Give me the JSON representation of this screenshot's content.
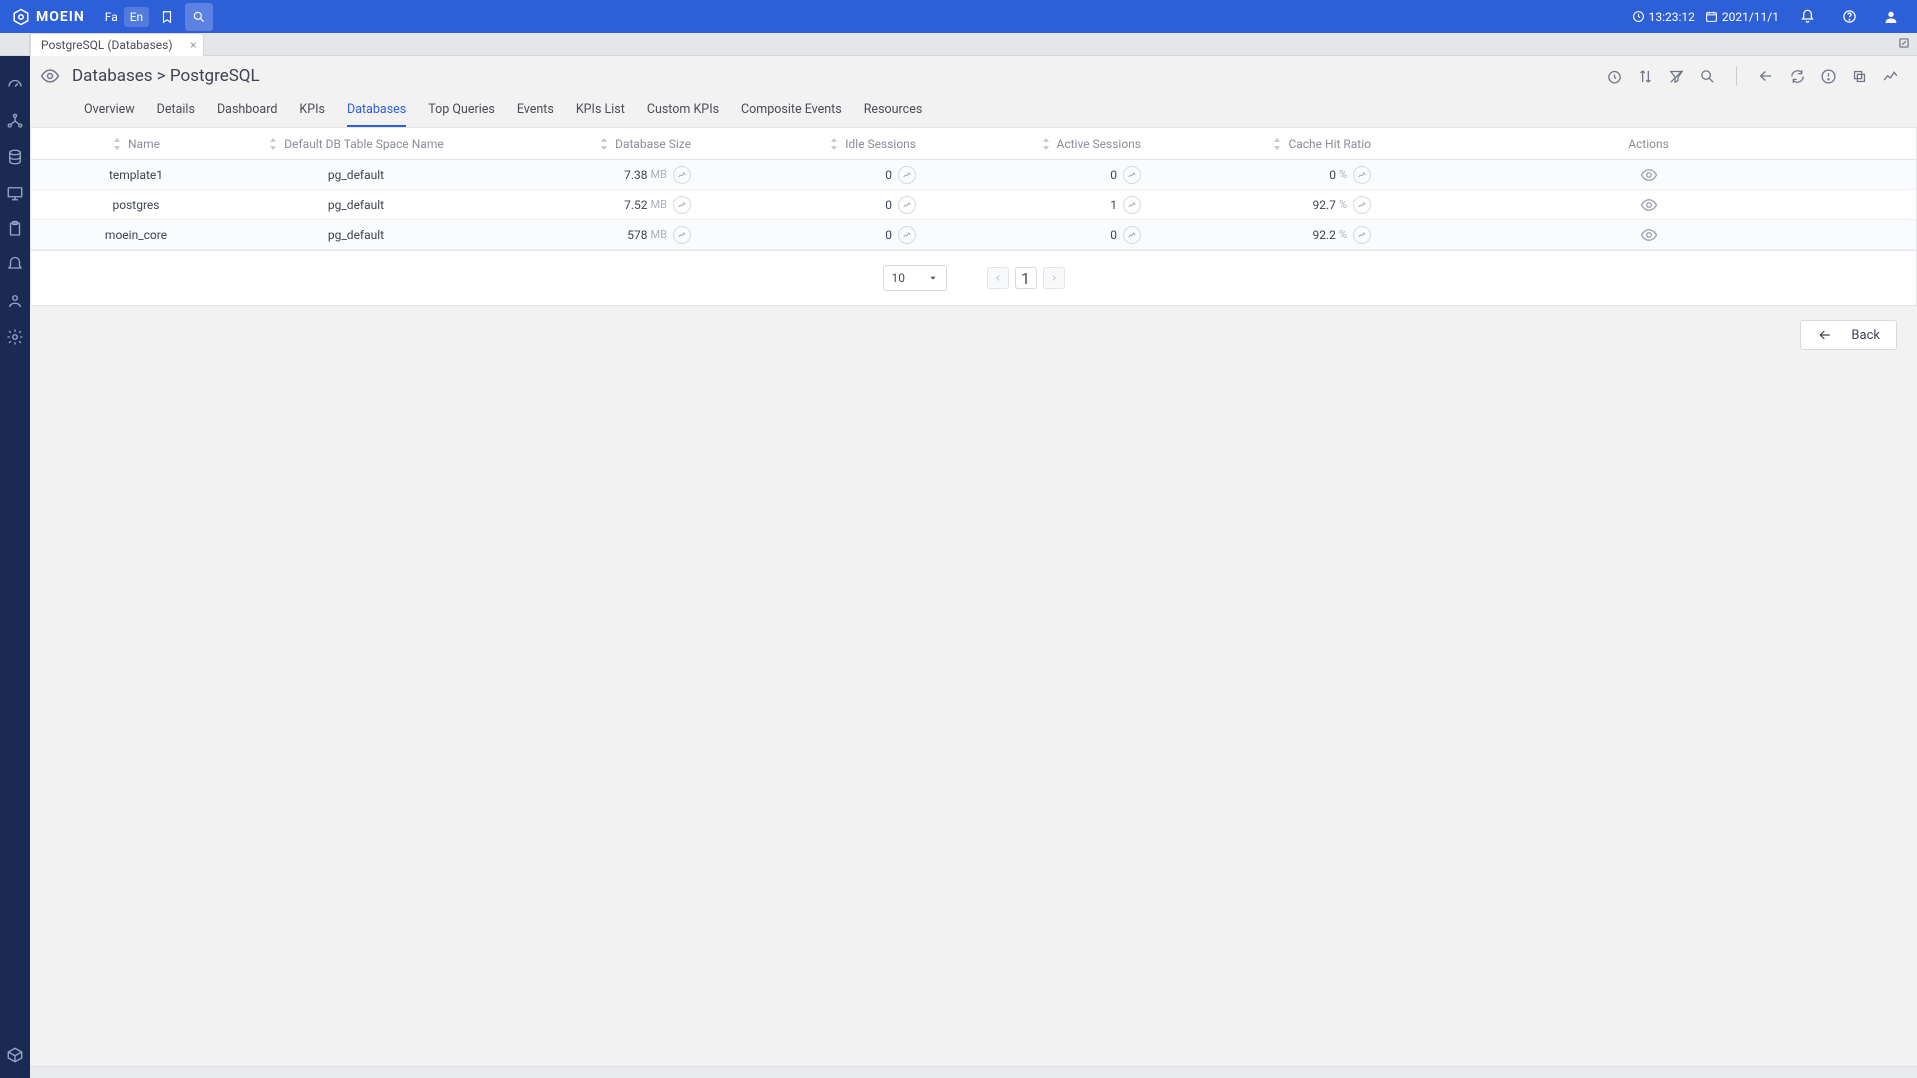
{
  "brand": "MOEIN",
  "header": {
    "lang_fa": "Fa",
    "lang_en": "En",
    "time": "13:23:12",
    "date": "2021/11/1"
  },
  "tab": {
    "label": "PostgreSQL (Databases)"
  },
  "breadcrumb": "Databases > PostgreSQL",
  "subnav": {
    "items": [
      "Overview",
      "Details",
      "Dashboard",
      "KPIs",
      "Databases",
      "Top Queries",
      "Events",
      "KPIs List",
      "Custom KPIs",
      "Composite Events",
      "Resources"
    ],
    "active_index": 4
  },
  "table": {
    "headers": {
      "name": "Name",
      "tablespace": "Default DB Table Space Name",
      "size": "Database Size",
      "idle": "Idle Sessions",
      "active": "Active Sessions",
      "chr": "Cache Hit Ratio",
      "actions": "Actions"
    },
    "rows": [
      {
        "name": "template1",
        "tablespace": "pg_default",
        "size_val": "7.38",
        "size_unit": "MB",
        "idle": "0",
        "active": "0",
        "chr_val": "0",
        "chr_unit": "%"
      },
      {
        "name": "postgres",
        "tablespace": "pg_default",
        "size_val": "7.52",
        "size_unit": "MB",
        "idle": "0",
        "active": "1",
        "chr_val": "92.7",
        "chr_unit": "%"
      },
      {
        "name": "moein_core",
        "tablespace": "pg_default",
        "size_val": "578",
        "size_unit": "MB",
        "idle": "0",
        "active": "0",
        "chr_val": "92.2",
        "chr_unit": "%"
      }
    ]
  },
  "pagination": {
    "page_size": "10",
    "current_page": "1"
  },
  "back_label": "Back"
}
